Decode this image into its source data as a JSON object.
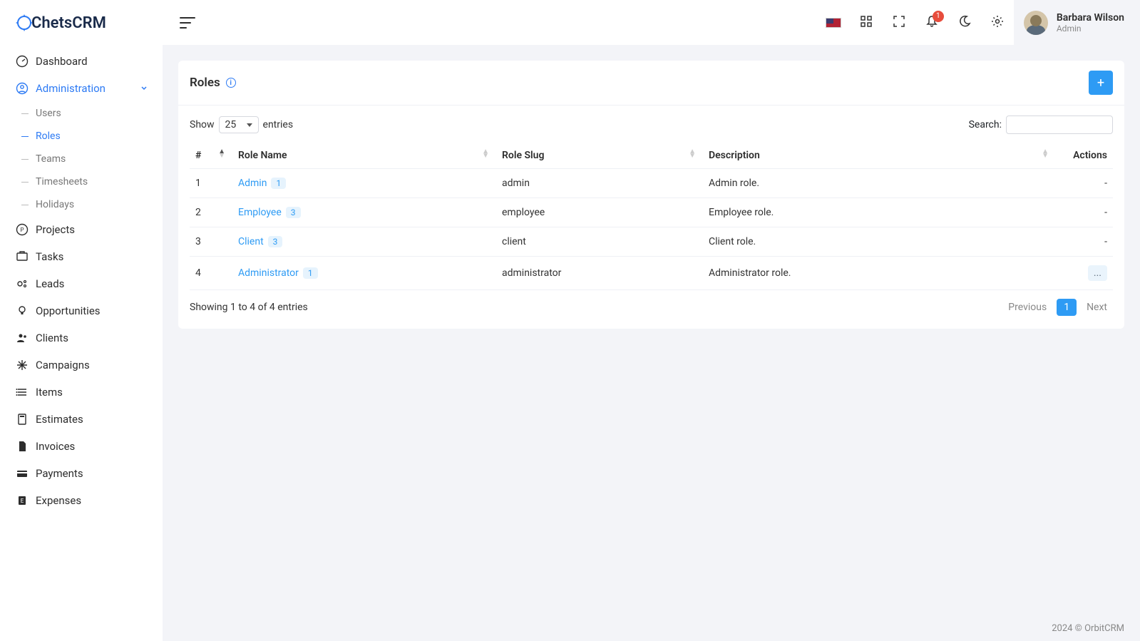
{
  "brand": {
    "prefix": "C",
    "rest": "hetsCRM"
  },
  "sidebar": {
    "items": [
      {
        "label": "Dashboard"
      },
      {
        "label": "Administration",
        "active": true,
        "expandable": true,
        "sub": [
          {
            "label": "Users"
          },
          {
            "label": "Roles",
            "active": true
          },
          {
            "label": "Teams"
          },
          {
            "label": "Timesheets"
          },
          {
            "label": "Holidays"
          }
        ]
      },
      {
        "label": "Projects"
      },
      {
        "label": "Tasks"
      },
      {
        "label": "Leads"
      },
      {
        "label": "Opportunities"
      },
      {
        "label": "Clients"
      },
      {
        "label": "Campaigns"
      },
      {
        "label": "Items"
      },
      {
        "label": "Estimates"
      },
      {
        "label": "Invoices"
      },
      {
        "label": "Payments"
      },
      {
        "label": "Expenses"
      }
    ]
  },
  "topbar": {
    "notification_count": "1",
    "user": {
      "name": "Barbara Wilson",
      "role": "Admin"
    }
  },
  "page": {
    "title": "Roles",
    "show_label": "Show",
    "entries_label": "entries",
    "page_size": "25",
    "search_label": "Search:",
    "columns": {
      "idx": "#",
      "name": "Role Name",
      "slug": "Role Slug",
      "desc": "Description",
      "actions": "Actions"
    },
    "rows": [
      {
        "idx": "1",
        "name": "Admin",
        "count": "1",
        "slug": "admin",
        "desc": "Admin role.",
        "actions": "-"
      },
      {
        "idx": "2",
        "name": "Employee",
        "count": "3",
        "slug": "employee",
        "desc": "Employee role.",
        "actions": "-"
      },
      {
        "idx": "3",
        "name": "Client",
        "count": "3",
        "slug": "client",
        "desc": "Client role.",
        "actions": "-"
      },
      {
        "idx": "4",
        "name": "Administrator",
        "count": "1",
        "slug": "administrator",
        "desc": "Administrator role.",
        "actions": "..."
      }
    ],
    "showing": "Showing 1 to 4 of 4 entries",
    "pagination": {
      "prev": "Previous",
      "page": "1",
      "next": "Next"
    }
  },
  "footer": "2024 © OrbitCRM"
}
